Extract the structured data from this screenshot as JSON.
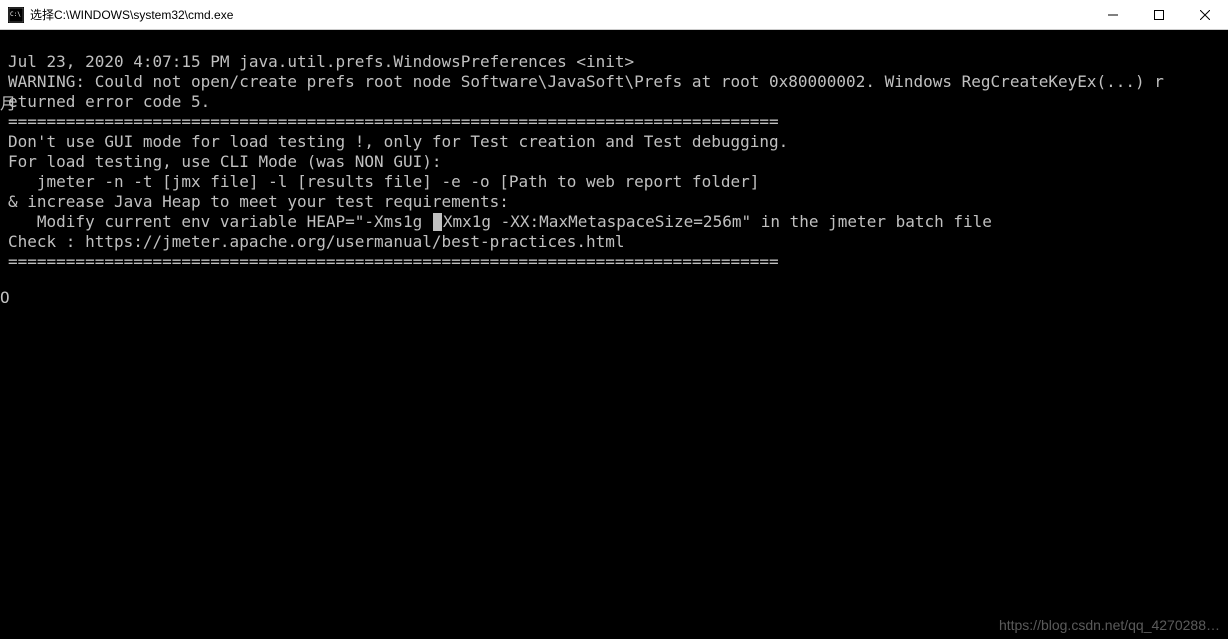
{
  "titlebar": {
    "title": "选择C:\\WINDOWS\\system32\\cmd.exe"
  },
  "terminal": {
    "line1": "Jul 23, 2020 4:07:15 PM java.util.prefs.WindowsPreferences <init>",
    "line2": "WARNING: Could not open/create prefs root node Software\\JavaSoft\\Prefs at root 0x80000002. Windows RegCreateKeyEx(...) r",
    "line3": "eturned error code 5.",
    "sep1": "================================================================================",
    "line4": "Don't use GUI mode for load testing !, only for Test creation and Test debugging.",
    "line5": "For load testing, use CLI Mode (was NON GUI):",
    "line6": "   jmeter -n -t [jmx file] -l [results file] -e -o [Path to web report folder]",
    "line7": "& increase Java Heap to meet your test requirements:",
    "line8a": "   Modify current env variable HEAP=\"-Xms1g ",
    "line8b": "Xmx1g -XX:MaxMetaspaceSize=256m\" in the jmeter batch file",
    "line9": "Check : https://jmeter.apache.org/usermanual/best-practices.html",
    "sep2": "================================================================================",
    "left_artifact_top": "月",
    "left_artifact_bottom": "O"
  },
  "watermark": "https://blog.csdn.net/qq_4270288…"
}
